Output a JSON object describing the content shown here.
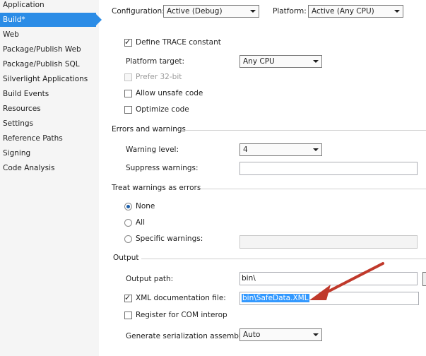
{
  "sidebar": {
    "items": [
      {
        "label": "Application"
      },
      {
        "label": "Build*"
      },
      {
        "label": "Web"
      },
      {
        "label": "Package/Publish Web"
      },
      {
        "label": "Package/Publish SQL"
      },
      {
        "label": "Silverlight Applications"
      },
      {
        "label": "Build Events"
      },
      {
        "label": "Resources"
      },
      {
        "label": "Settings"
      },
      {
        "label": "Reference Paths"
      },
      {
        "label": "Signing"
      },
      {
        "label": "Code Analysis"
      }
    ]
  },
  "top": {
    "configuration_label": "Configuration:",
    "configuration_value": "Active (Debug)",
    "platform_label": "Platform:",
    "platform_value": "Active (Any CPU)"
  },
  "general": {
    "define_trace_label": "Define TRACE constant",
    "define_trace_checked": true,
    "platform_target_label": "Platform target:",
    "platform_target_value": "Any CPU",
    "prefer32_label": "Prefer 32-bit",
    "allow_unsafe_label": "Allow unsafe code",
    "optimize_label": "Optimize code"
  },
  "errors": {
    "section_label": "Errors and warnings",
    "warning_level_label": "Warning level:",
    "warning_level_value": "4",
    "suppress_label": "Suppress warnings:",
    "suppress_value": ""
  },
  "treat": {
    "section_label": "Treat warnings as errors",
    "none_label": "None",
    "all_label": "All",
    "specific_label": "Specific warnings:",
    "selected": "None"
  },
  "output": {
    "section_label": "Output",
    "output_path_label": "Output path:",
    "output_path_value": "bin\\",
    "xml_doc_label": "XML documentation file:",
    "xml_doc_checked": true,
    "xml_doc_value": "bin\\SafeData.XML",
    "com_interop_label": "Register for COM interop",
    "serialization_label": "Generate serialization assembly:",
    "serialization_value": "Auto"
  },
  "colors": {
    "accent": "#2b8ce6",
    "annotation_arrow": "#c0392b"
  }
}
